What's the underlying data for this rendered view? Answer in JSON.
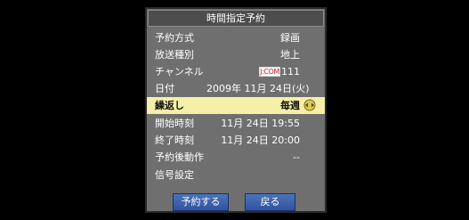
{
  "dialog": {
    "title": "時間指定予約",
    "fields": [
      {
        "label": "予約方式",
        "value": "録画"
      },
      {
        "label": "放送種別",
        "value": "地上"
      },
      {
        "label": "チャンネル",
        "value": "111",
        "logo_text": "J:COM"
      },
      {
        "label": "日付",
        "value": "2009年 11月 24日(火)"
      },
      {
        "label": "繰返し",
        "value": "毎週"
      },
      {
        "label": "開始時刻",
        "value": "11月 24日 19:55"
      },
      {
        "label": "終了時刻",
        "value": "11月 24日 20:00"
      },
      {
        "label": "予約後動作",
        "value": "--"
      },
      {
        "label": "信号設定",
        "value": ""
      }
    ],
    "buttons": {
      "reserve": "予約する",
      "back": "戻る"
    }
  },
  "icons": {
    "spinner": "left-right-spinner-icon"
  },
  "colors": {
    "panel": "#6f6f6f",
    "title_bar": "#4d4d4d",
    "selected_row": "#f6efa8",
    "button": "#3d64ae"
  }
}
